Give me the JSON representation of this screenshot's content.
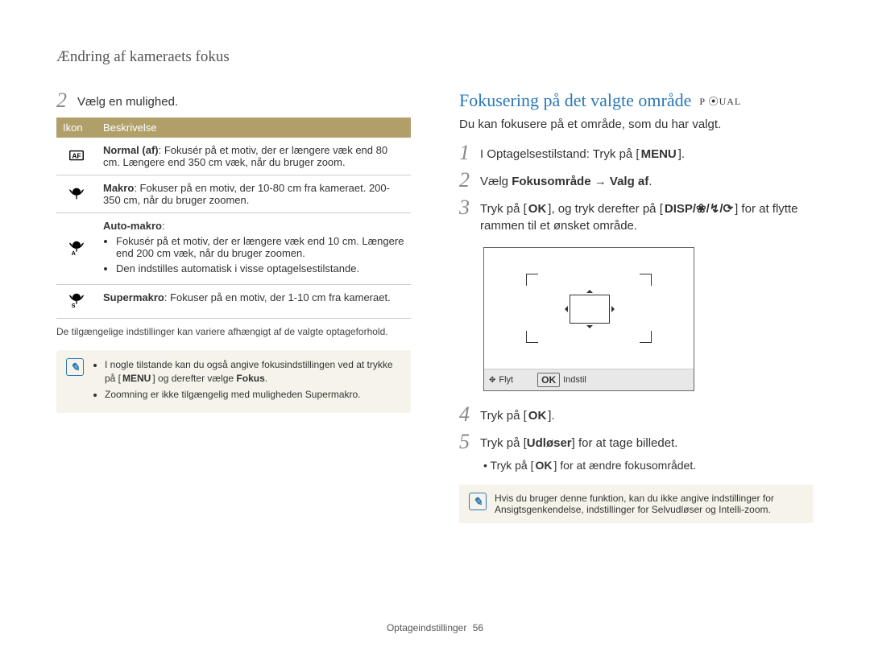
{
  "header": {
    "title": "Ændring af kameraets fokus"
  },
  "left": {
    "step2_num": "2",
    "step2_text": "Vælg en mulighed.",
    "table": {
      "col_icon": "Ikon",
      "col_desc": "Beskrivelse",
      "rows": [
        {
          "name": "normal-af",
          "title": "Normal (af)",
          "body": ": Fokusér på et motiv, der er længere væk end 80 cm. Længere end 350 cm væk, når du bruger zoom."
        },
        {
          "name": "makro",
          "title": "Makro",
          "body": ": Fokuser på en motiv, der 10-80 cm fra kameraet. 200-350 cm, når du bruger zoomen."
        },
        {
          "name": "auto-makro",
          "title": "Auto-makro",
          "body_suffix": ":",
          "bullets": [
            "Fokusér på et motiv, der er længere væk end 10 cm. Længere end 200 cm væk, når du bruger zoomen.",
            "Den indstilles automatisk i visse optagelsestilstande."
          ]
        },
        {
          "name": "supermakro",
          "title": "Supermakro",
          "body": ": Fokuser på en motiv, der 1-10 cm fra kameraet."
        }
      ]
    },
    "footnote": "De tilgængelige indstillinger kan variere afhængigt af de valgte optageforhold.",
    "tip": {
      "bullets_a": "I nogle tilstande kan du også angive fokusindstillingen ved at trykke på [",
      "bullets_a_menu": "MENU",
      "bullets_a2": "] og derefter vælge ",
      "bullets_a_bold": "Fokus",
      "bullets_a3": ".",
      "bullets_b": "Zoomning er ikke tilgængelig med muligheden Supermakro."
    }
  },
  "right": {
    "section_title": "Fokusering på det valgte område",
    "section_modes": "P  ⦿UAL",
    "intro": "Du kan fokusere på et område, som du har valgt.",
    "step1_num": "1",
    "step1_a": "I Optagelsestilstand: Tryk på [",
    "step1_menu": "MENU",
    "step1_b": "].",
    "step2_num": "2",
    "step2_a": "Vælg ",
    "step2_b": "Fokusområde",
    "step2_arrow": " → ",
    "step2_c": "Valg af",
    "step2_d": ".",
    "step3_num": "3",
    "step3_a": "Tryk på [",
    "step3_ok": "OK",
    "step3_b": "], og tryk derefter på [",
    "step3_keys": "DISP/❀/↯/⟳",
    "step3_c": "] for at flytte rammen til et ønsket område.",
    "screen": {
      "move": "Flyt",
      "set": "Indstil"
    },
    "step4_num": "4",
    "step4_a": "Tryk på [",
    "step4_ok": "OK",
    "step4_b": "].",
    "step5_num": "5",
    "step5_a": "Tryk på [",
    "step5_key": "Udløser",
    "step5_b": "] for at tage billedet.",
    "step5_sub_a": "Tryk på [",
    "step5_sub_ok": "OK",
    "step5_sub_b": "] for at ændre fokusområdet.",
    "tip": "Hvis du bruger denne funktion, kan du ikke angive indstillinger for Ansigtsgenkendelse, indstillinger for Selvudløser og Intelli-zoom."
  },
  "footer": {
    "section": "Optageindstillinger",
    "page": "56"
  }
}
